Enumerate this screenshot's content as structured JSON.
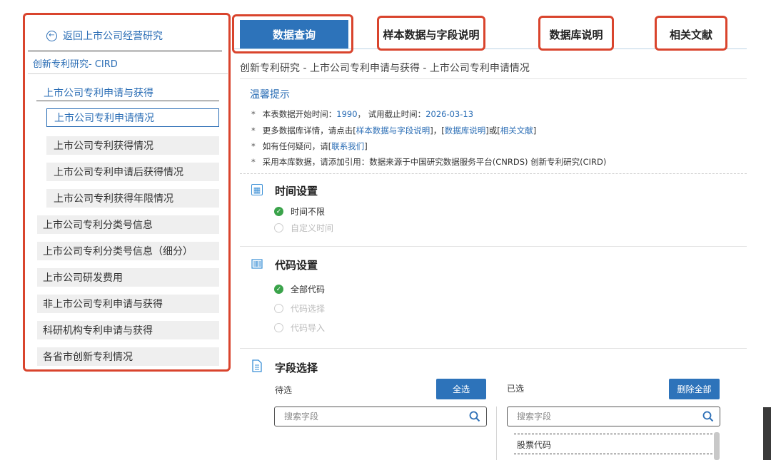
{
  "sidebar": {
    "back_label": "返回上市公司经营研究",
    "db_name": "创新专利研究- CIRD",
    "section_label": "上市公司专利申请与获得",
    "sub_items": [
      "上市公司专利申请情况",
      "上市公司专利获得情况",
      "上市公司专利申请后获得情况",
      "上市公司专利获得年限情况"
    ],
    "categories": [
      "上市公司专利分类号信息",
      "上市公司专利分类号信息（细分）",
      "上市公司研发费用",
      "非上市公司专利申请与获得",
      "科研机构专利申请与获得",
      "各省市创新专利情况"
    ]
  },
  "tabs": {
    "data_query": "数据查询",
    "sample_data": "样本数据与字段说明",
    "db_desc": "数据库说明",
    "literature": "相关文献"
  },
  "breadcrumb": "创新专利研究 - 上市公司专利申请与获得 - 上市公司专利申请情况",
  "tips": {
    "title": "温馨提示",
    "line1_prefix": "本表数据开始时间：",
    "start_year": "1990",
    "line1_mid": "，  试用截止时间：",
    "trial_end": "2026-03-13",
    "line2_prefix": "更多数据库详情，请点击[",
    "line2_link1": "样本数据与字段说明",
    "line2_mid1": "]，[",
    "line2_link2": "数据库说明",
    "line2_mid2": "]或[",
    "line2_link3": "相关文献",
    "line2_suffix": "]",
    "line3_prefix": "如有任何疑问，请[",
    "line3_link": "联系我们",
    "line3_suffix": "]",
    "line4": "采用本库数据，请添加引用：数据来源于中国研究数据服务平台(CNRDS) 创新专利研究(CIRD)"
  },
  "time_settings": {
    "title": "时间设置",
    "options": [
      "时间不限",
      "自定义时间"
    ],
    "selected": "时间不限"
  },
  "code_settings": {
    "title": "代码设置",
    "options": [
      "全部代码",
      "代码选择",
      "代码导入"
    ],
    "selected": "全部代码"
  },
  "field_select": {
    "title": "字段选择",
    "pending_label": "待选",
    "select_all": "全选",
    "selected_label": "已选",
    "delete_all": "删除全部",
    "search_placeholder": "搜索字段",
    "selected_items": [
      "股票代码"
    ]
  }
}
